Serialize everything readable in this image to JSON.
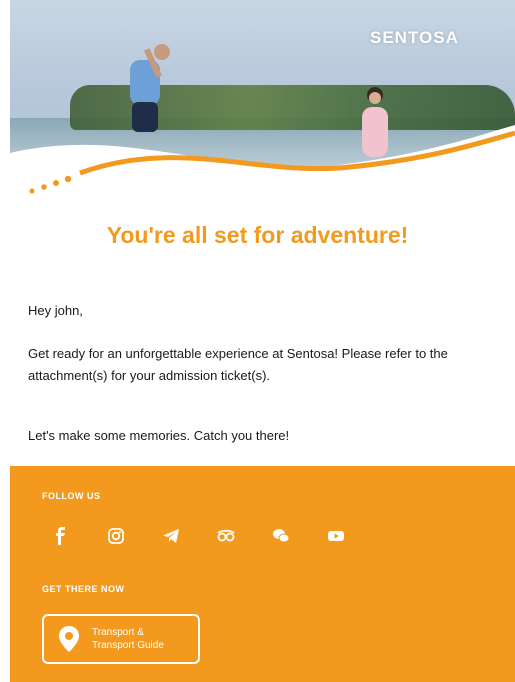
{
  "brand": {
    "logo_text": "SENTOSA"
  },
  "headline": "You're all set for adventure!",
  "greeting": "Hey john,",
  "message": "Get ready for an unforgettable experience at Sentosa! Please refer to the attachment(s) for your admission ticket(s).",
  "closing": "Let's make some memories. Catch you there!",
  "footer": {
    "follow_label": "FOLLOW US",
    "get_there_label": "GET THERE NOW",
    "socials": [
      "facebook-icon",
      "instagram-icon",
      "telegram-icon",
      "tripadvisor-icon",
      "wechat-icon",
      "youtube-icon"
    ],
    "transport_button": {
      "line1": "Transport &",
      "line2": "Transport Guide"
    }
  },
  "colors": {
    "accent": "#f39a1e",
    "text": "#1a1a1a",
    "background": "#ffffff"
  }
}
